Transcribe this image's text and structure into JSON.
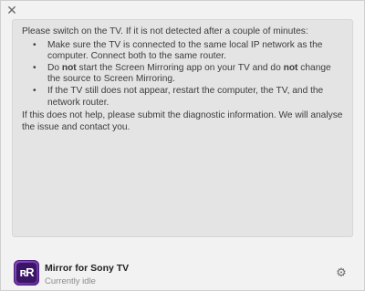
{
  "window": {
    "close_glyph": "✕"
  },
  "message": {
    "intro": "Please switch on the TV. If it is not detected after a couple of minutes:",
    "tips": [
      {
        "parts": [
          "Make sure the TV is connected to the same local IP network as the computer. Connect both to the same router."
        ]
      },
      {
        "parts": [
          "Do ",
          "not",
          " start the Screen Mirroring app on your TV and do ",
          "not",
          " change the source to Screen Mirroring."
        ]
      },
      {
        "parts": [
          "If the TV still does not appear, restart the computer, the TV, and the network router."
        ]
      }
    ],
    "outro": "If this does not help, please submit the diagnostic information. We will analyse the issue and contact you."
  },
  "footer": {
    "app_icon_letters": "ʀR",
    "app_name": "Mirror for Sony TV",
    "status": "Currently idle",
    "settings_icon": "gear-icon"
  },
  "colors": {
    "accent": "#6b33a8"
  }
}
